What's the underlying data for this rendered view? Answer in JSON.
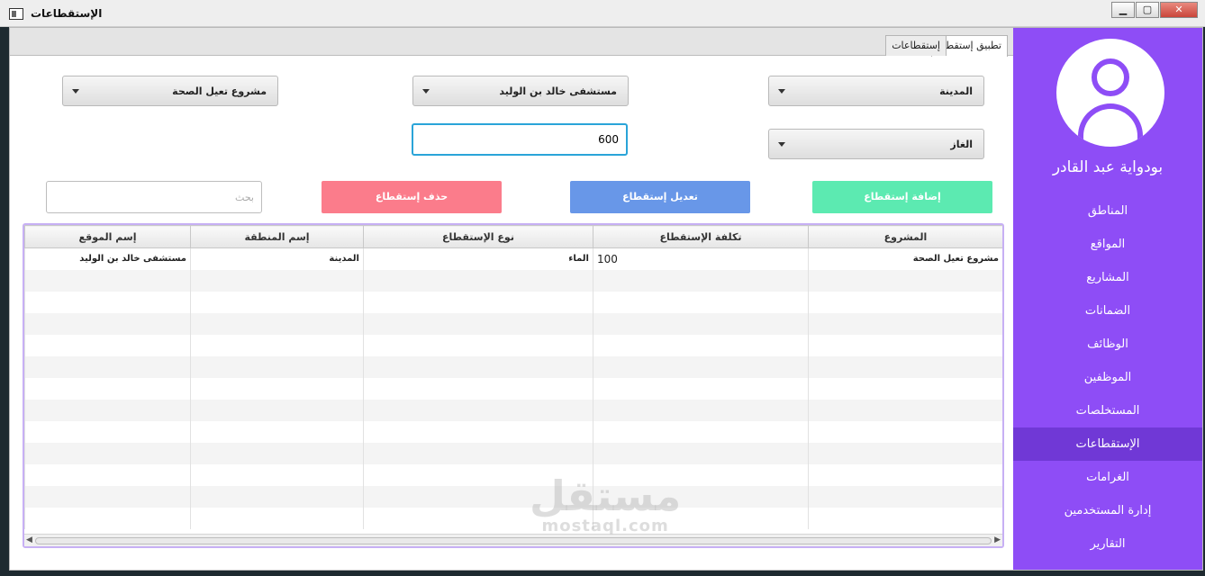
{
  "window": {
    "title": "الإستقطاعات"
  },
  "tabs": [
    {
      "label": "تطبيق إستقطاع"
    },
    {
      "label": "إستقطاعات"
    }
  ],
  "sidebar": {
    "username": "بودواية عبد القادر",
    "items": [
      {
        "label": "المناطق"
      },
      {
        "label": "المواقع"
      },
      {
        "label": "المشاريع"
      },
      {
        "label": "الضمانات"
      },
      {
        "label": "الوظائف"
      },
      {
        "label": "الموظفين"
      },
      {
        "label": "المستخلصات"
      },
      {
        "label": "الإستقطاعات"
      },
      {
        "label": "الغرامات"
      },
      {
        "label": "إدارة المستخدمين"
      },
      {
        "label": "التقارير"
      }
    ],
    "active_index": 7
  },
  "form": {
    "region": "المدينة",
    "site": "مستشفى خالد بن الوليد",
    "project": "مشروع تعيل الصحة",
    "deduction_type": "الغاز",
    "amount": "600",
    "search_placeholder": "بحث"
  },
  "buttons": {
    "add": "إضافة إستقطاع",
    "edit": "تعديل إستقطاع",
    "delete": "حذف إستقطاع"
  },
  "table": {
    "columns": [
      "المشروع",
      "تكلفة الإستقطاع",
      "نوع الإستقطاع",
      "إسم المنطقة",
      "إسم الموقع"
    ],
    "rows": [
      [
        "مشروع تعيل الصحة",
        "100",
        "الماء",
        "المدينة",
        "مستشفى خالد بن الوليد"
      ]
    ]
  },
  "watermark": {
    "arabic": "مستقل",
    "latin": "mostaql.com"
  },
  "colors": {
    "sidebar": "#8e4df6",
    "sidebar_active": "#7038d6",
    "add": "#5ceab1",
    "edit": "#6897e8",
    "delete": "#fb7c8b"
  }
}
